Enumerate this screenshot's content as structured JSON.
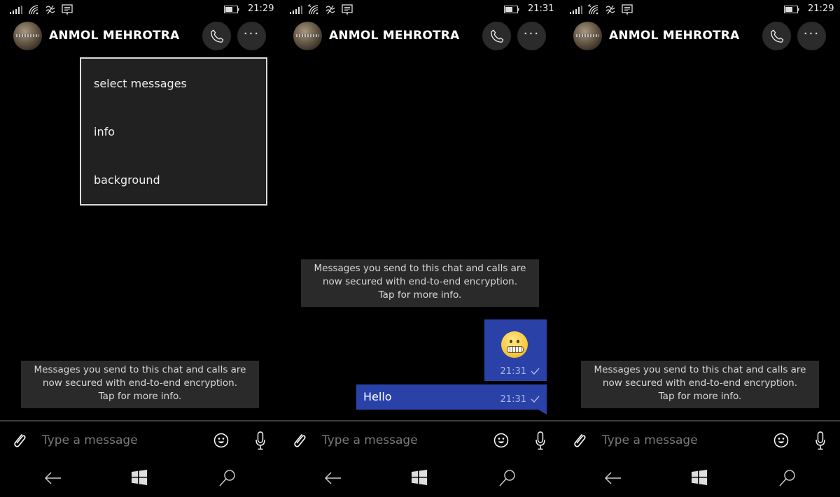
{
  "colors": {
    "background": "#000000",
    "bubble": "#2a42a8",
    "notice_bg": "#2a2a2a",
    "menu_bg": "#212121",
    "menu_border": "#dcdcdc",
    "button_bg": "#2b2b2b"
  },
  "icons": {
    "signal": "signal-bars-icon",
    "wifi": "wifi-icon",
    "vibrate": "vibrate-icon",
    "message_notification": "message-notification-icon",
    "battery": "battery-icon",
    "call": "phone-icon",
    "more": "more-dots-icon",
    "attach": "paperclip-icon",
    "emoji": "smiley-icon",
    "mic": "microphone-icon",
    "back": "back-arrow-icon",
    "windows": "windows-logo-icon",
    "search": "search-icon"
  },
  "panels": [
    {
      "status": {
        "time": "21:29"
      },
      "header": {
        "contact_name": "ANMOL MEHROTRA"
      },
      "menu": {
        "items": [
          "select messages",
          "info",
          "background"
        ]
      },
      "notice": {
        "line1": "Messages you send to this chat and calls are",
        "line2": "now secured with end-to-end encryption.",
        "line3": "Tap for more info."
      },
      "input": {
        "placeholder": "Type a message"
      }
    },
    {
      "status": {
        "time": "21:31"
      },
      "header": {
        "contact_name": "ANMOL MEHROTRA"
      },
      "notice": {
        "line1": "Messages you send to this chat and calls are",
        "line2": "now secured with end-to-end encryption.",
        "line3": "Tap for more info."
      },
      "messages": [
        {
          "type": "emoji",
          "content": "grimacing-face",
          "time": "21:31",
          "status": "sent"
        },
        {
          "type": "text",
          "content": "Hello",
          "time": "21:31",
          "status": "sent"
        }
      ],
      "input": {
        "placeholder": "Type a message"
      }
    },
    {
      "status": {
        "time": "21:29"
      },
      "header": {
        "contact_name": "ANMOL MEHROTRA"
      },
      "notice": {
        "line1": "Messages you send to this chat and calls are",
        "line2": "now secured with end-to-end encryption.",
        "line3": "Tap for more info."
      },
      "input": {
        "placeholder": "Type a message"
      }
    }
  ]
}
